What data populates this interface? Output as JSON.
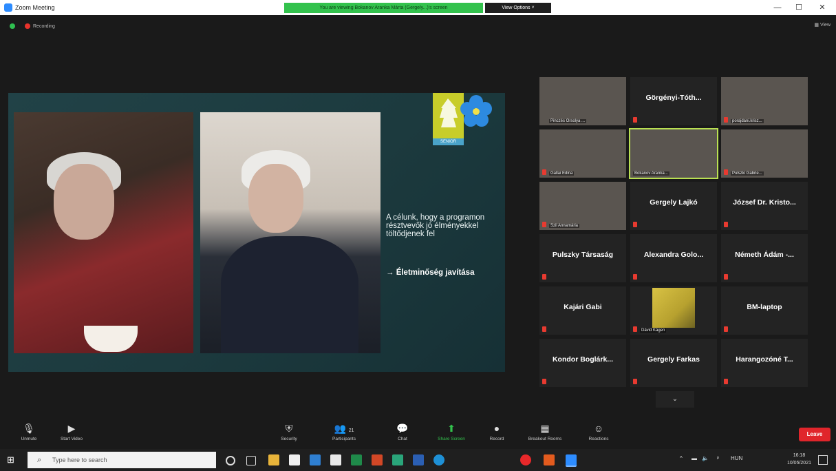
{
  "window": {
    "title": "Zoom Meeting",
    "share_banner": "You are viewing Bokanov Aranka Márta (Gergely...)'s screen",
    "view_options": "View Options ˅",
    "minimize": "—",
    "maximize": "☐",
    "close": "✕"
  },
  "status": {
    "recording": "Recording",
    "view": "View"
  },
  "slide": {
    "logo_label": "SENIOR",
    "text": "A célunk, hogy a programon résztvevők jó élményekkel töltődjenek fel",
    "goal": "→ Életminőség javítása"
  },
  "participants": [
    {
      "name": "Pinczés Orsolya ...",
      "video": true
    },
    {
      "name": "Görgényi-Tóth...",
      "video": false
    },
    {
      "name": "porajdani.krisz...",
      "video": true
    },
    {
      "name": "Gallai Edina",
      "video": true
    },
    {
      "name": "Bokanov Aranka...",
      "video": true,
      "active": true
    },
    {
      "name": "Pulszki Gabrie...",
      "video": true
    },
    {
      "name": "Szil Annamária",
      "video": true
    },
    {
      "name": "Gergely Lajkó",
      "video": false
    },
    {
      "name": "József Dr. Kristo...",
      "video": false
    },
    {
      "name": "Pulszky Társaság",
      "video": false
    },
    {
      "name": "Alexandra Golo...",
      "video": false
    },
    {
      "name": "Németh Ádám -...",
      "video": false
    },
    {
      "name": "Kajári Gabi",
      "video": false
    },
    {
      "name": "Dávid Kágen",
      "video": true
    },
    {
      "name": "BM-laptop",
      "video": false
    },
    {
      "name": "Kondor Boglárk...",
      "video": false
    },
    {
      "name": "Gergely Farkas",
      "video": false
    },
    {
      "name": "Harangozóné T...",
      "video": false
    }
  ],
  "pager": "⌄",
  "toolbar": {
    "unmute": "Unmute",
    "start_video": "Start Video",
    "security": "Security",
    "participants": "Participants",
    "participants_count": "21",
    "chat": "Chat",
    "share_screen": "Share Screen",
    "record": "Record",
    "breakout": "Breakout Rooms",
    "reactions": "Reactions",
    "leave": "Leave"
  },
  "taskbar": {
    "search_placeholder": "Type here to search",
    "lang": "HUN",
    "time": "16:18",
    "date": "10/05/2021"
  },
  "colors": {
    "share_green": "#33c24d",
    "leave_red": "#e0252b",
    "slide_bg": "#1f3e42",
    "active_border": "#b9e052"
  }
}
